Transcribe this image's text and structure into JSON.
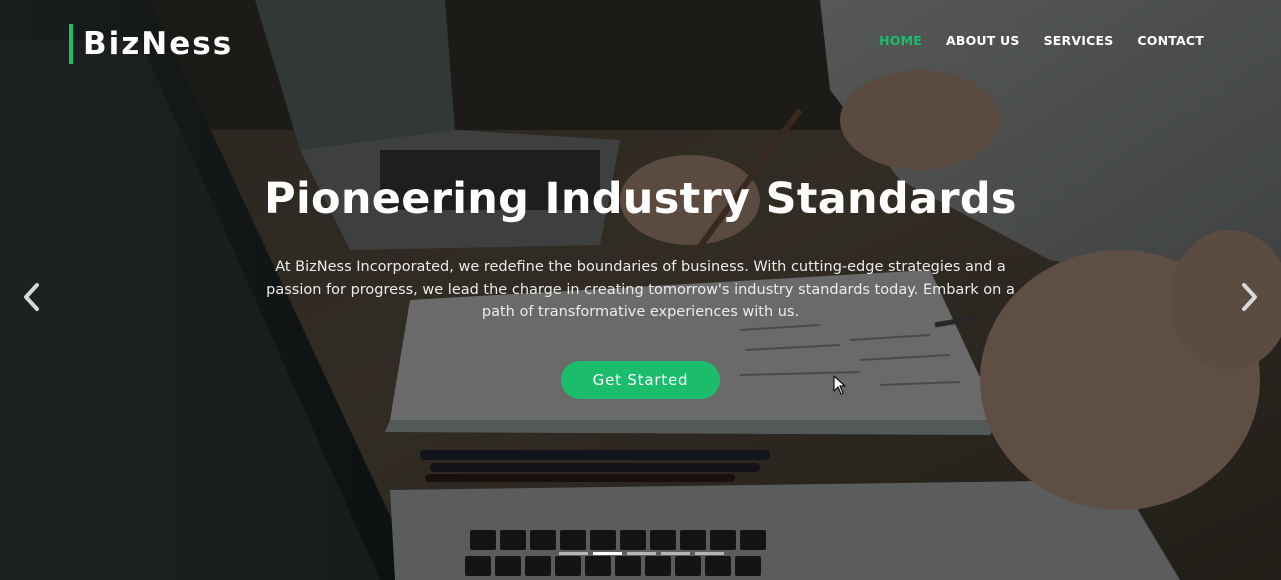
{
  "brand": {
    "name": "BizNess",
    "accent_color": "#1bbd6c"
  },
  "nav": {
    "items": [
      {
        "label": "HOME",
        "active": true
      },
      {
        "label": "ABOUT US",
        "active": false
      },
      {
        "label": "SERVICES",
        "active": false
      },
      {
        "label": "CONTACT",
        "active": false
      }
    ]
  },
  "hero": {
    "headline": "Pioneering Industry Standards",
    "body": "At BizNess Incorporated, we redefine the boundaries of business. With cutting-edge strategies and a passion for progress, we lead the charge in creating tomorrow's industry standards today. Embark on a path of transformative experiences with us.",
    "cta_label": "Get Started"
  },
  "carousel": {
    "prev_icon": "chevron-left-icon",
    "next_icon": "chevron-right-icon",
    "slide_count": 5,
    "active_slide": 2
  }
}
